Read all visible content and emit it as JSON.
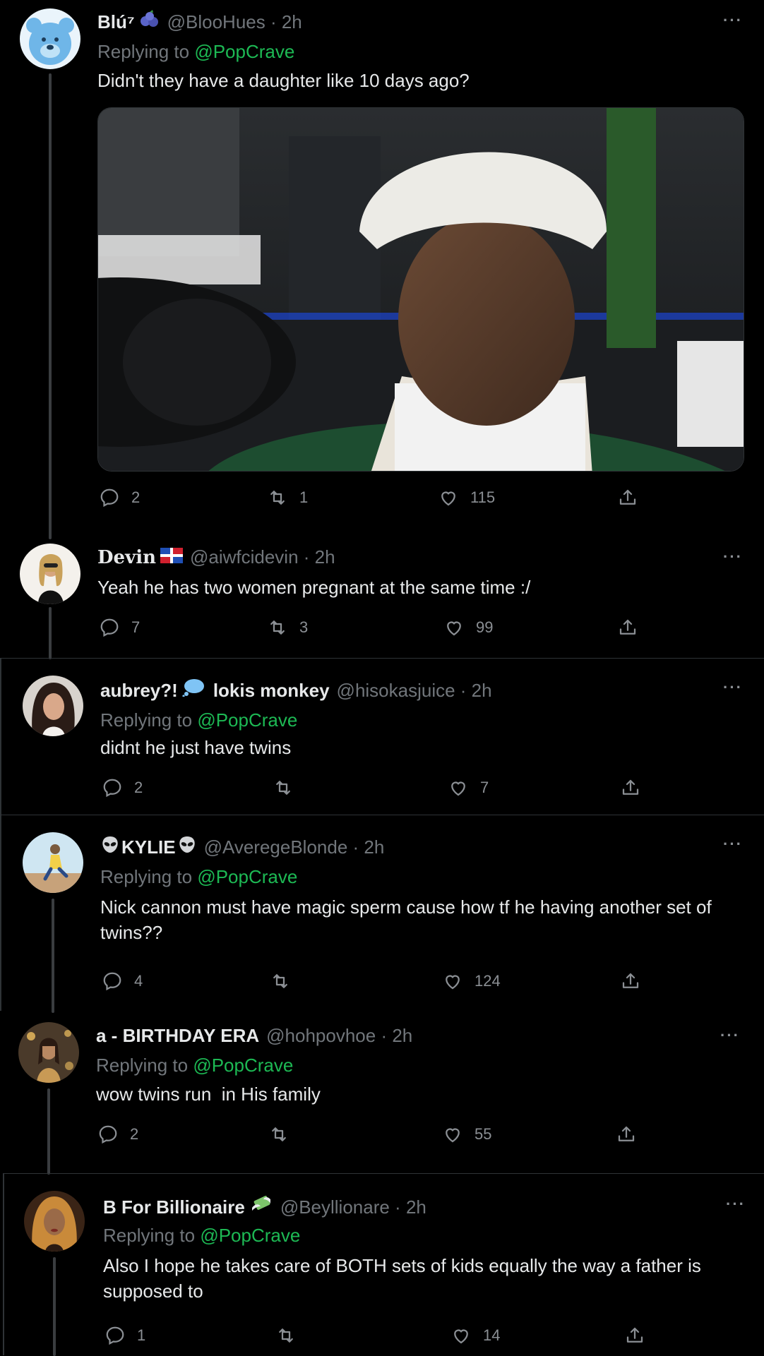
{
  "reply_prefix": "Replying to",
  "more_glyph": "···",
  "colors": {
    "background": "#000000",
    "text": "#e7e9ea",
    "secondary": "#71767b",
    "mention": "#1db954",
    "divider": "#2f3336"
  },
  "tweets": [
    {
      "name": "Blú⁷",
      "name_emoji": "blueberries-icon",
      "handle": "@BlooHues · 2h",
      "reply_to": "@PopCrave",
      "text": "Didn't they have a daughter like 10 days ago?",
      "media": "photo-man-white-beanie-microphone",
      "replies": "2",
      "retweets": "1",
      "likes": "115"
    },
    {
      "name": "Devin",
      "name_emoji": "dominican-flag-icon",
      "handle": "@aiwfcidevin · 2h",
      "text": "Yeah he has two women pregnant at the same time :/",
      "replies": "7",
      "retweets": "3",
      "likes": "99"
    },
    {
      "name": "aubrey?!",
      "name_emoji": "speech-bubble-icon",
      "name_suffix": "lokis monkey",
      "handle": "@hisokasjuice · 2h",
      "reply_to": "@PopCrave",
      "text": "didnt he just have twins",
      "replies": "2",
      "retweets": "",
      "likes": "7"
    },
    {
      "name": "KYLIE",
      "name_emoji": "alien-icon",
      "handle": "@AveregeBlonde · 2h",
      "reply_to": "@PopCrave",
      "text": "Nick cannon must have magic sperm cause how tf he having another set of twins??",
      "replies": "4",
      "retweets": "",
      "likes": "124"
    },
    {
      "name": "a - BIRTHDAY ERA",
      "handle": "@hohpovhoe · 2h",
      "reply_to": "@PopCrave",
      "text": "wow twins run  in His family",
      "replies": "2",
      "retweets": "",
      "likes": "55"
    },
    {
      "name": "B For Billionaire",
      "name_emoji": "money-with-wings-icon",
      "handle": "@Beyllionare · 2h",
      "reply_to": "@PopCrave",
      "text": "Also I hope he takes care of BOTH sets of kids equally the way a father is supposed to",
      "replies": "1",
      "retweets": "",
      "likes": "14"
    }
  ]
}
